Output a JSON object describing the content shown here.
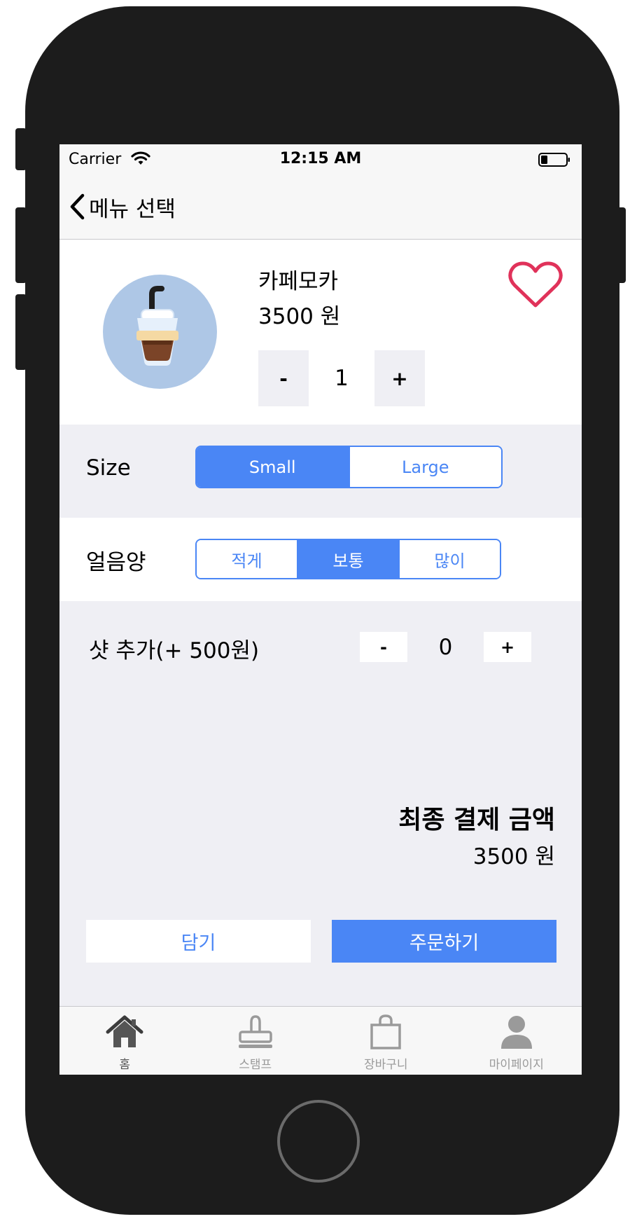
{
  "status_bar": {
    "carrier": "Carrier",
    "time": "12:15 AM"
  },
  "nav": {
    "back_label": "메뉴 선택"
  },
  "product": {
    "name": "카페모카",
    "price": "3500 원",
    "favorite_icon": "heart-outline-icon",
    "image_icon": "iced-coffee-cup-icon"
  },
  "quantity": {
    "minus_label": "-",
    "value": "1",
    "plus_label": "+"
  },
  "size": {
    "label": "Size",
    "options": [
      "Small",
      "Large"
    ],
    "selected": "Small"
  },
  "ice": {
    "label": "얼음양",
    "options": [
      "적게",
      "보통",
      "많이"
    ],
    "selected": "보통"
  },
  "shot": {
    "label": "샷 추가(+ 500원)",
    "minus_label": "-",
    "value": "0",
    "plus_label": "+"
  },
  "total": {
    "label": "최종 결제 금액",
    "amount": "3500 원"
  },
  "actions": {
    "cart_label": "담기",
    "order_label": "주문하기"
  },
  "tabs": [
    {
      "label": "홈",
      "icon": "home-icon",
      "active": true
    },
    {
      "label": "스탬프",
      "icon": "stamp-icon",
      "active": false
    },
    {
      "label": "장바구니",
      "icon": "shopping-bag-icon",
      "active": false
    },
    {
      "label": "마이페이지",
      "icon": "user-icon",
      "active": false
    }
  ],
  "colors": {
    "accent": "#4a86f5",
    "heart": "#e0325a",
    "background": "#efeff4",
    "phone_body": "#1c1c1c"
  }
}
